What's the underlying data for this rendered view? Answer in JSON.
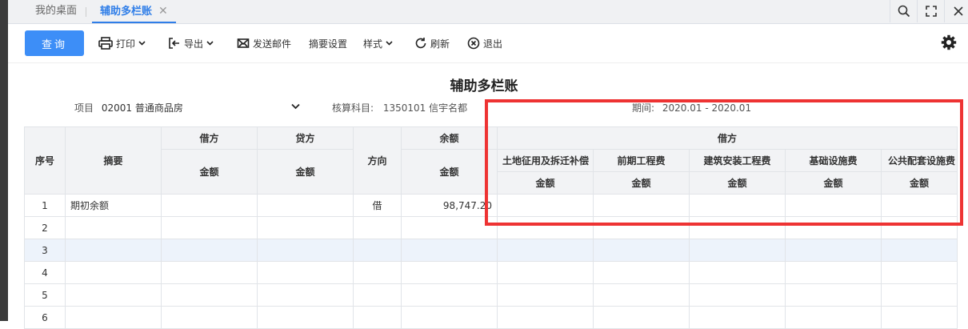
{
  "tabs": {
    "home": "我的桌面",
    "active": "辅助多栏账",
    "close": "✕"
  },
  "toolbar": {
    "query": "查询",
    "print": "打印",
    "export": "导出",
    "email": "发送邮件",
    "summary_settings": "摘要设置",
    "style": "样式",
    "refresh": "刷新",
    "exit": "退出"
  },
  "report": {
    "title": "辅助多栏账",
    "project_label": "项目",
    "project_value": "02001 普通商品房",
    "account_label": "核算科目:",
    "account_value": "1350101 信宇名都",
    "period_label": "期间:",
    "period_value": "2020.01 - 2020.01"
  },
  "table": {
    "headers": {
      "seq": "序号",
      "summary": "摘要",
      "debit": "借方",
      "credit": "贷方",
      "direction": "方向",
      "balance": "余额",
      "amount": "金额",
      "debit_group": "借方",
      "cols": [
        "土地征用及拆迁补偿",
        "前期工程费",
        "建筑安装工程费",
        "基础设施费",
        "公共配套设施费"
      ]
    },
    "rows": [
      {
        "seq": "1",
        "summary": "期初余额",
        "debit": "",
        "credit": "",
        "dir": "借",
        "balance": "98,747.20"
      },
      {
        "seq": "2",
        "summary": "",
        "debit": "",
        "credit": "",
        "dir": "",
        "balance": ""
      },
      {
        "seq": "3",
        "summary": "",
        "debit": "",
        "credit": "",
        "dir": "",
        "balance": ""
      },
      {
        "seq": "4",
        "summary": "",
        "debit": "",
        "credit": "",
        "dir": "",
        "balance": ""
      },
      {
        "seq": "5",
        "summary": "",
        "debit": "",
        "credit": "",
        "dir": "",
        "balance": ""
      },
      {
        "seq": "6",
        "summary": "",
        "debit": "",
        "credit": "",
        "dir": "",
        "balance": ""
      }
    ]
  }
}
